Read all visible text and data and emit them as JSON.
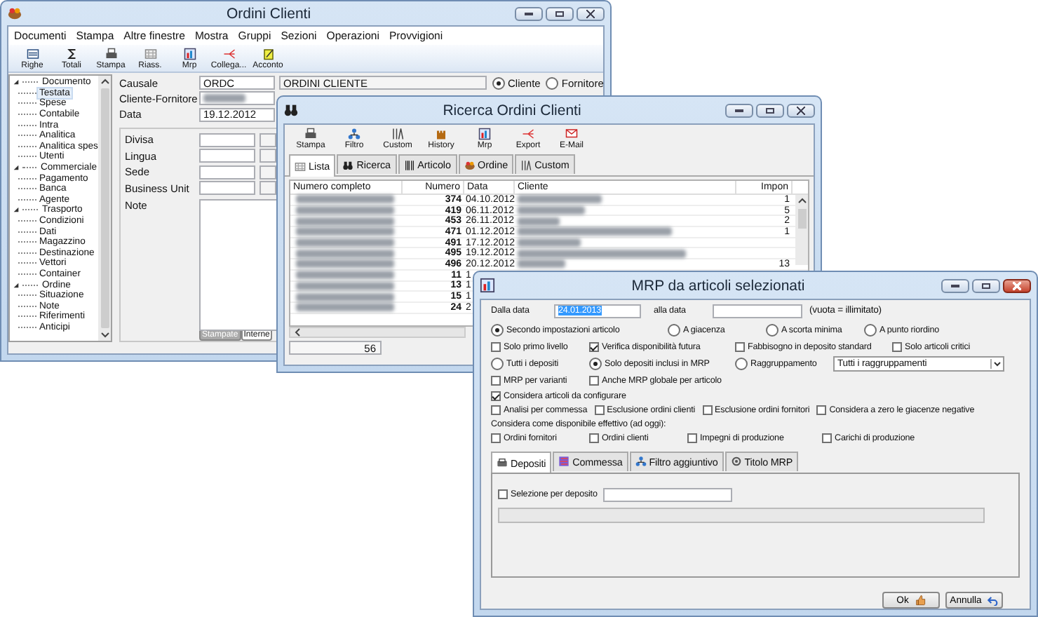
{
  "order_window": {
    "title": "Ordini Clienti",
    "menu": [
      "Documenti",
      "Stampa",
      "Altre finestre",
      "Mostra",
      "Gruppi",
      "Sezioni",
      "Operazioni",
      "Provvigioni"
    ],
    "toolbar": [
      "Righe",
      "Totali",
      "Stampa",
      "Riass.",
      "Mrp",
      "Collega...",
      "Acconto"
    ],
    "tree": [
      {
        "label": "Documento",
        "expanded": true,
        "children": [
          {
            "label": "Testata",
            "selected": true
          },
          {
            "label": "Spese",
            "selected": false
          },
          {
            "label": "Contabile",
            "selected": false
          },
          {
            "label": "Intra",
            "selected": false
          },
          {
            "label": "Analitica",
            "selected": false
          },
          {
            "label": "Analitica spes",
            "selected": false
          },
          {
            "label": "Utenti",
            "selected": false
          }
        ]
      },
      {
        "label": "Commerciale",
        "expanded": true,
        "children": [
          {
            "label": "Pagamento",
            "selected": false
          },
          {
            "label": "Banca",
            "selected": false
          },
          {
            "label": "Agente",
            "selected": false
          }
        ]
      },
      {
        "label": "Trasporto",
        "expanded": true,
        "children": [
          {
            "label": "Condizioni",
            "selected": false
          },
          {
            "label": "Dati",
            "selected": false
          },
          {
            "label": "Magazzino",
            "selected": false
          },
          {
            "label": "Destinazione",
            "selected": false
          },
          {
            "label": "Vettori",
            "selected": false
          },
          {
            "label": "Container",
            "selected": false
          }
        ]
      },
      {
        "label": "Ordine",
        "expanded": true,
        "children": [
          {
            "label": "Situazione",
            "selected": false
          },
          {
            "label": "Note",
            "selected": false
          },
          {
            "label": "Riferimenti",
            "selected": false
          },
          {
            "label": "Anticipi",
            "selected": false
          }
        ]
      }
    ],
    "causale": {
      "label": "Causale",
      "value": "ORDC",
      "description": "ORDINI CLIENTE"
    },
    "party_label": "Cliente-Fornitore",
    "party_type": [
      {
        "label": "Cliente",
        "selected": true
      },
      {
        "label": "Fornitore",
        "selected": false
      }
    ],
    "date": {
      "label": "Data",
      "value": "19.12.2012"
    },
    "fields": [
      "Divisa",
      "Lingua",
      "Sede",
      "Business Unit"
    ],
    "note_label": "Note",
    "note_tabs": [
      {
        "label": "Stampate",
        "selected": true
      },
      {
        "label": "Interne",
        "selected": false
      }
    ]
  },
  "search_window": {
    "title": "Ricerca Ordini Clienti",
    "toolbar": [
      "Stampa",
      "Filtro",
      "Custom",
      "History",
      "Mrp",
      "Export",
      "E-Mail"
    ],
    "tabs": [
      {
        "label": "Lista",
        "selected": true
      },
      {
        "label": "Ricerca",
        "selected": false
      },
      {
        "label": "Articolo",
        "selected": false
      },
      {
        "label": "Ordine",
        "selected": false
      },
      {
        "label": "Custom",
        "selected": false
      }
    ],
    "columns": [
      "Numero completo",
      "Numero",
      "Data",
      "Cliente",
      "Impon"
    ],
    "rows": [
      {
        "numero": "374",
        "data": "04.10.2012",
        "importo": "1"
      },
      {
        "numero": "419",
        "data": "06.11.2012",
        "importo": "5"
      },
      {
        "numero": "453",
        "data": "26.11.2012",
        "importo": "2"
      },
      {
        "numero": "471",
        "data": "01.12.2012",
        "importo": "1"
      },
      {
        "numero": "491",
        "data": "17.12.2012"
      },
      {
        "numero": "495",
        "data": "19.12.2012"
      },
      {
        "numero": "496",
        "data": "20.12.2012",
        "importo": "13"
      },
      {
        "numero": "11",
        "data": "1"
      },
      {
        "numero": "13",
        "data": "1"
      },
      {
        "numero": "15",
        "data": "1"
      },
      {
        "numero": "24",
        "data": "2"
      }
    ],
    "count": "56"
  },
  "mrp_window": {
    "title": "MRP da articoli selezionati",
    "date_from": {
      "label": "Dalla data",
      "value": "24.01.2013"
    },
    "date_to": {
      "label": "alla data"
    },
    "date_hint": "(vuota = illimitato)",
    "calc_mode": [
      {
        "label": "Secondo impostazioni articolo",
        "selected": true
      },
      {
        "label": "A giacenza",
        "selected": false
      },
      {
        "label": "A scorta minima",
        "selected": false
      },
      {
        "label": "A punto riordino",
        "selected": false
      }
    ],
    "options_a": [
      {
        "label": "Solo primo livello",
        "checked": false
      },
      {
        "label": "Verifica disponibilità futura",
        "checked": true
      },
      {
        "label": "Fabbisogno in deposito standard",
        "checked": false
      },
      {
        "label": "Solo articoli critici",
        "checked": false
      }
    ],
    "deposit_mode": [
      {
        "label": "Tutti i depositi",
        "selected": false
      },
      {
        "label": "Solo depositi inclusi in MRP",
        "selected": true
      },
      {
        "label": "Raggruppamento",
        "selected": false
      }
    ],
    "grouping": "Tutti i raggruppamenti",
    "options_b": [
      {
        "label": "MRP per varianti",
        "checked": false
      },
      {
        "label": "Anche MRP globale per articolo",
        "checked": false
      }
    ],
    "options_c": [
      {
        "label": "Considera articoli da configurare",
        "checked": true
      }
    ],
    "options_d": [
      {
        "label": "Analisi per commessa",
        "checked": false
      },
      {
        "label": "Esclusione ordini clienti",
        "checked": false
      },
      {
        "label": "Esclusione ordini fornitori",
        "checked": false
      },
      {
        "label": "Considera a zero le giacenze negative",
        "checked": false
      }
    ],
    "available_label": "Considera come disponibile effettivo (ad oggi):",
    "available": [
      {
        "label": "Ordini fornitori",
        "checked": false
      },
      {
        "label": "Ordini clienti",
        "checked": false
      },
      {
        "label": "Impegni di produzione",
        "checked": false
      },
      {
        "label": "Carichi di produzione",
        "checked": false
      }
    ],
    "tabs": [
      {
        "label": "Depositi",
        "selected": true
      },
      {
        "label": "Commessa",
        "selected": false
      },
      {
        "label": "Filtro aggiuntivo",
        "selected": false
      },
      {
        "label": "Titolo MRP",
        "selected": false
      }
    ],
    "deposit_selection": {
      "label": "Selezione per deposito",
      "checked": false
    },
    "buttons": [
      "Ok",
      "Annulla"
    ]
  }
}
